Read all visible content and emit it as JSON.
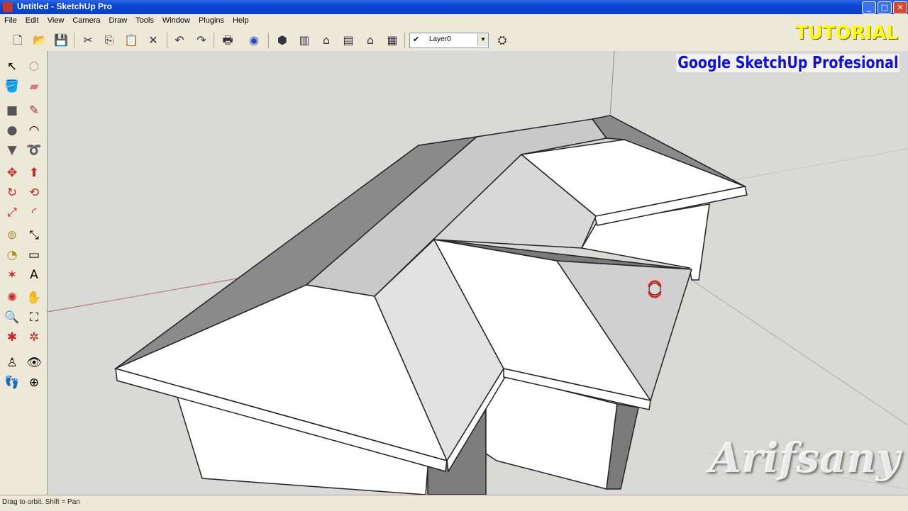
{
  "window": {
    "title": "Untitled - SketchUp Pro"
  },
  "menu": [
    "File",
    "Edit",
    "View",
    "Camera",
    "Draw",
    "Tools",
    "Window",
    "Plugins",
    "Help"
  ],
  "toolbar": {
    "layer_value": "Layer0"
  },
  "overlay": {
    "tutorial": "TUTORIAL",
    "subtitle": "Google SketchUp Profesional",
    "watermark": "Arifsany"
  },
  "status": {
    "text": "Drag to orbit.  Shift = Pan"
  },
  "colors": {
    "title_bar": "#0a46d6",
    "chrome": "#ece9d8",
    "canvas": "#d9d9d7",
    "overlay_yellow": "#ffff00",
    "overlay_blue": "#1010d8"
  }
}
